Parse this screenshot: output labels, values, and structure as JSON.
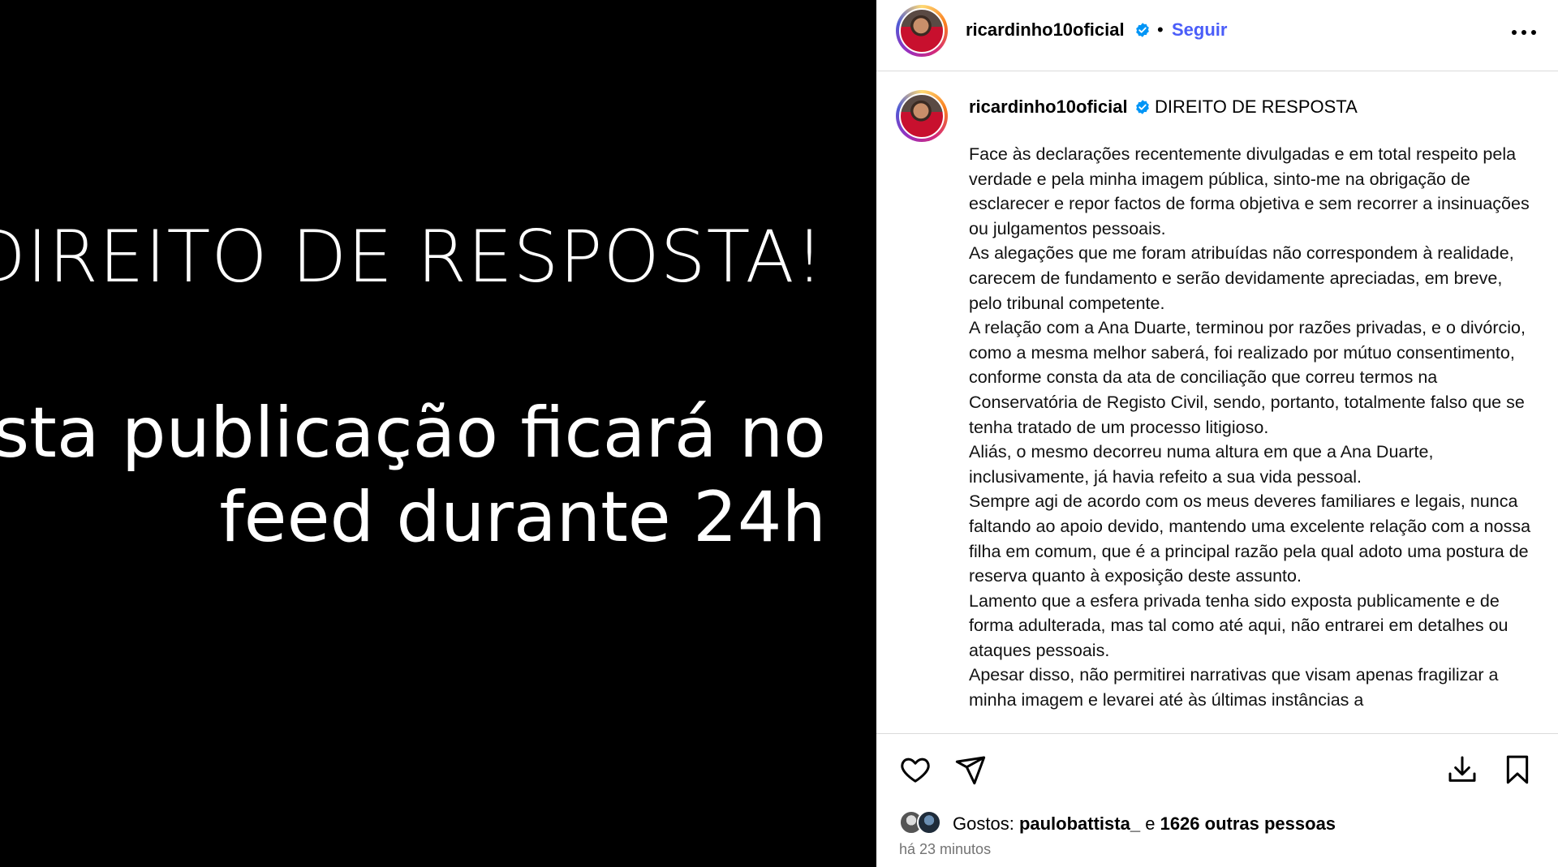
{
  "media": {
    "headline": "DIREITO DE RESPOSTA!",
    "sub_lines": [
      "Esta publicação ficará no",
      "feed durante 24h"
    ]
  },
  "header": {
    "username": "ricardinho10oficial",
    "separator": "•",
    "follow_label": "Seguir"
  },
  "caption": {
    "username": "ricardinho10oficial",
    "title": "DIREITO DE RESPOSTA",
    "paragraphs": [
      "Face às declarações recentemente divulgadas e em total respeito pela verdade e pela minha imagem pública, sinto-me na obrigação de esclarecer e repor factos de forma objetiva e sem recorrer a insinuações ou julgamentos pessoais.",
      "As alegações que me foram atribuídas não correspondem à realidade, carecem de fundamento e serão devidamente apreciadas, em breve, pelo tribunal competente.",
      "A relação com a Ana Duarte, terminou por razões privadas, e o divórcio, como a mesma melhor saberá, foi realizado por mútuo consentimento, conforme consta da ata de conciliação que correu termos na Conservatória de Registo Civil, sendo, portanto, totalmente falso que se tenha tratado de um processo litigioso.",
      "Aliás, o mesmo decorreu numa altura em que a Ana Duarte, inclusivamente, já havia refeito a sua vida pessoal.",
      "Sempre agi de acordo com os meus deveres familiares e legais, nunca faltando ao apoio devido, mantendo uma excelente relação com a nossa filha em comum, que é a principal razão pela qual adoto uma postura de reserva quanto à exposição deste assunto.",
      "Lamento que a esfera privada tenha sido exposta publicamente e de forma adulterada, mas tal como até aqui, não entrarei em detalhes ou ataques pessoais.",
      "Apesar disso, não permitirei narrativas que visam apenas fragilizar a minha imagem e levarei até às últimas instâncias a"
    ]
  },
  "likes": {
    "prefix": "Gostos:",
    "user": "paulobattista_",
    "conjunction": "e",
    "others": "1626 outras pessoas"
  },
  "timestamp": "há 23 minutos",
  "colors": {
    "follow": "#4a5df9",
    "verified": "#0095f6",
    "timestamp": "#737373"
  },
  "icons": [
    "verified-badge-icon",
    "more-options-icon",
    "heart-icon",
    "share-icon",
    "download-icon",
    "bookmark-icon"
  ]
}
